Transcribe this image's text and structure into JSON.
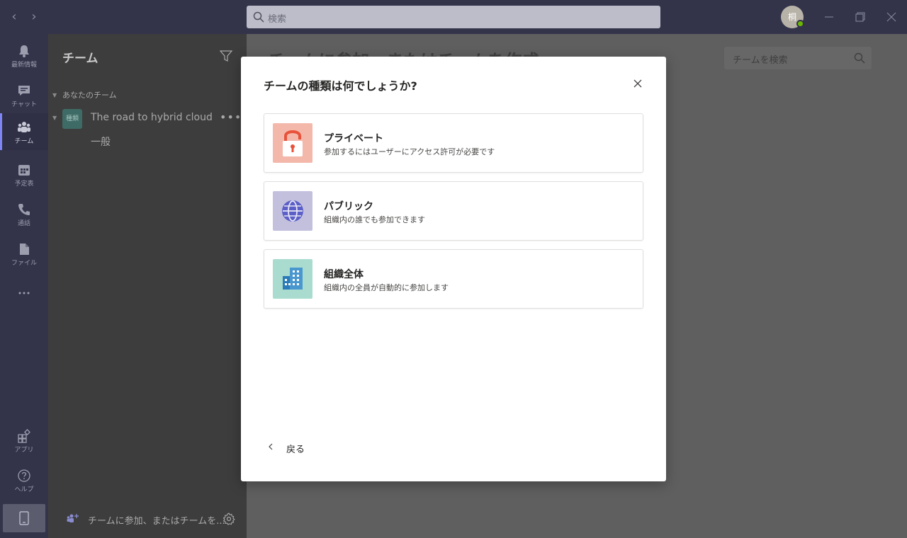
{
  "titlebar": {
    "search_placeholder": "検索",
    "avatar_initial": "桐"
  },
  "rail": {
    "items": [
      {
        "label": "最新情報",
        "icon": "bell-icon"
      },
      {
        "label": "チャット",
        "icon": "chat-icon"
      },
      {
        "label": "チーム",
        "icon": "teams-icon"
      },
      {
        "label": "予定表",
        "icon": "calendar-icon"
      },
      {
        "label": "通話",
        "icon": "phone-icon"
      },
      {
        "label": "ファイル",
        "icon": "file-icon"
      },
      {
        "label": "アプリ",
        "icon": "apps-icon"
      },
      {
        "label": "ヘルプ",
        "icon": "help-icon"
      }
    ],
    "active": "チーム"
  },
  "panel": {
    "title": "チーム",
    "section_label": "あなたのチーム",
    "team": {
      "avatar_text": "種類",
      "name": "The road to hybrid cloud",
      "channel": "一般"
    },
    "join_label": "チームに参加、またはチームを..."
  },
  "main": {
    "title": "チームに参加、またはチームを作成",
    "team_search_placeholder": "チームを検索"
  },
  "dialog": {
    "title": "チームの種類は何でしょうか?",
    "options": [
      {
        "title": "プライベート",
        "description": "参加するにはユーザーにアクセス許可が必要です",
        "icon": "lock-icon",
        "tile_color": "#f4b8ab"
      },
      {
        "title": "パブリック",
        "description": "組織内の誰でも参加できます",
        "icon": "globe-icon",
        "tile_color": "#c3c0de"
      },
      {
        "title": "組織全体",
        "description": "組織内の全員が自動的に参加します",
        "icon": "building-icon",
        "tile_color": "#a9dccf"
      }
    ],
    "back_label": "戻る"
  },
  "colors": {
    "rail_bg": "#33344a",
    "accent": "#7f85f5",
    "dialog_bg": "#ffffff",
    "overlay": "#5f5f5f"
  }
}
